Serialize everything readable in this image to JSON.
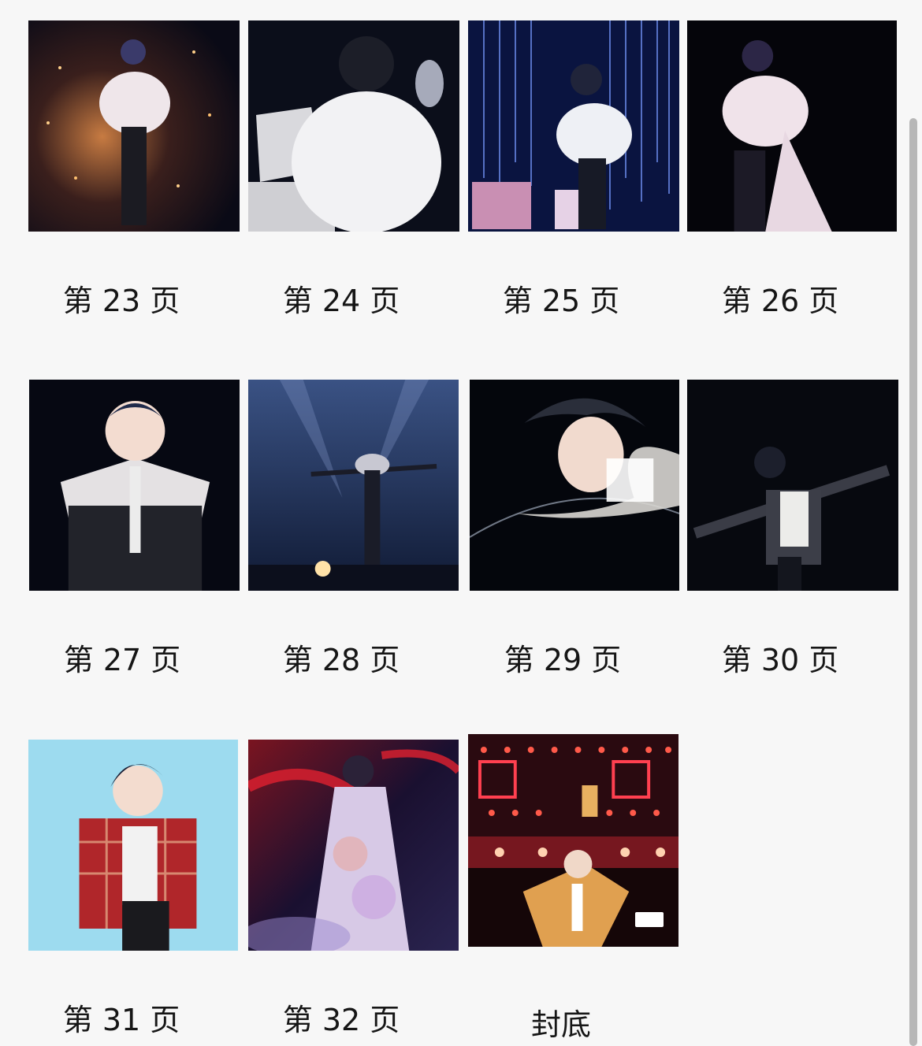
{
  "gallery": {
    "pages": [
      {
        "label": "第 23 页",
        "scene": "stage-sparkle-white-ruffle"
      },
      {
        "label": "第 24 页",
        "scene": "piano-white-ruffle-back"
      },
      {
        "label": "第 25 页",
        "scene": "blue-light-curtain"
      },
      {
        "label": "第 26 页",
        "scene": "dark-stage-white-cape"
      },
      {
        "label": "第 27 页",
        "scene": "closeup-studded-jacket"
      },
      {
        "label": "第 28 页",
        "scene": "spotlight-arms-outstretched"
      },
      {
        "label": "第 29 页",
        "scene": "side-profile-looking-down"
      },
      {
        "label": "第 30 页",
        "scene": "arms-wide-denim-jacket"
      },
      {
        "label": "第 31 页",
        "scene": "light-blue-red-plaid"
      },
      {
        "label": "第 32 页",
        "scene": "red-stage-floral-cape"
      },
      {
        "label": "封底",
        "scene": "neon-sign-gold-jacket"
      }
    ]
  },
  "colors": {
    "background": "#f7f7f7",
    "label_text": "#161616",
    "scrollbar": "#b7b7b7"
  }
}
